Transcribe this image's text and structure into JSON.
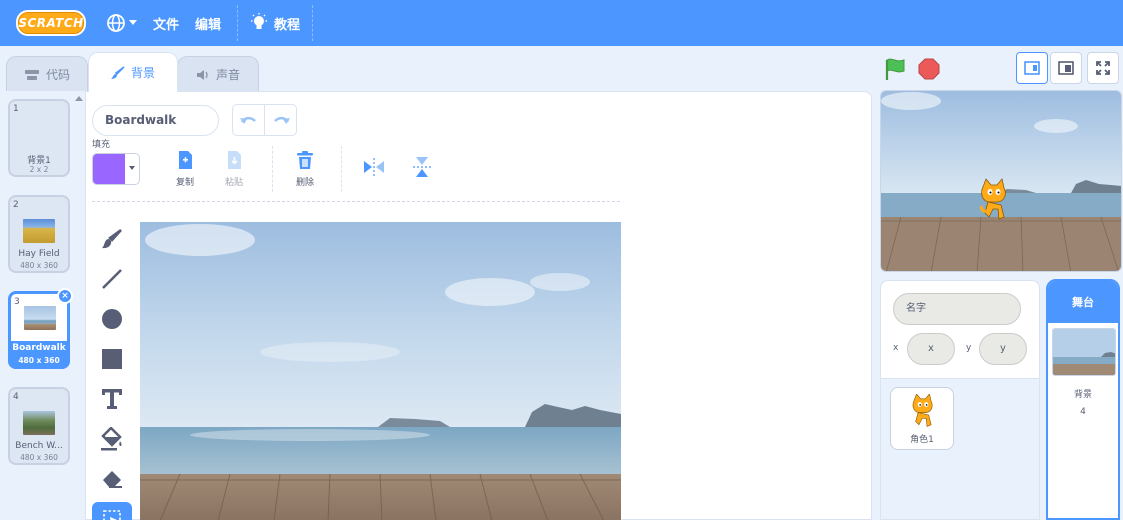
{
  "menu": {
    "logo": "SCRATCH",
    "file": "文件",
    "edit": "编辑",
    "tutorials": "教程"
  },
  "tabs": [
    {
      "label": "代码",
      "icon": "code-icon"
    },
    {
      "label": "背景",
      "icon": "brush-icon",
      "active": true
    },
    {
      "label": "声音",
      "icon": "speaker-icon"
    }
  ],
  "costumes": [
    {
      "num": "1",
      "name": "背景1",
      "size": "2 x 2"
    },
    {
      "num": "2",
      "name": "Hay Field",
      "size": "480 x 360"
    },
    {
      "num": "3",
      "name": "Boardwalk",
      "size": "480 x 360",
      "selected": true
    },
    {
      "num": "4",
      "name": "Bench W...",
      "size": "480 x 360"
    }
  ],
  "editor": {
    "costume_name": "Boardwalk",
    "fill_label": "填充",
    "fill_color": "#9966ff",
    "copy_label": "复制",
    "paste_label": "粘贴",
    "delete_label": "删除"
  },
  "sprite_info": {
    "name_placeholder": "名字",
    "x_label": "x",
    "x_placeholder": "x",
    "y_label": "y",
    "y_placeholder": "y"
  },
  "sprites": [
    {
      "name": "角色1"
    }
  ],
  "stage_selector": {
    "header": "舞台",
    "backdrops_label": "背景",
    "backdrops_count": "4"
  },
  "colors": {
    "accent": "#4c97ff",
    "fill": "#9966ff",
    "flag": "#4cbf56",
    "stop": "#ec5959"
  }
}
